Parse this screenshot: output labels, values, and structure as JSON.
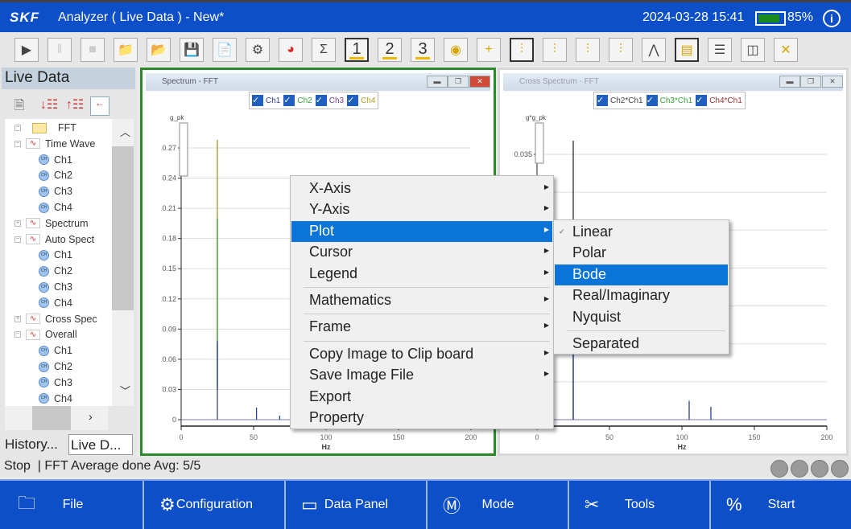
{
  "titlebar": {
    "logo": "SKF",
    "title": "Analyzer ( Live Data ) - New*",
    "datetime": "2024-03-28 15:41",
    "battery_percent": 85,
    "battery_label": "85%",
    "info_icon": "info-icon"
  },
  "toolbar": {
    "buttons": [
      "play",
      "pause",
      "stop",
      "new-folder",
      "open-folder",
      "save",
      "new-report",
      "settings",
      "pie-chart",
      "sigma",
      "layout-1",
      "layout-2",
      "layout-3",
      "view-file",
      "add-cursor",
      "single-cursor",
      "harmonic-cursor",
      "band-cursor",
      "sideband-cursor",
      "peak-cursor",
      "annotation",
      "split-horizontal",
      "split-vertical",
      "close-window"
    ],
    "layout_labels": [
      "1",
      "2",
      "3"
    ]
  },
  "left_panel": {
    "title": "Live Data",
    "tree": [
      {
        "label": "FFT",
        "type": "folder",
        "level": 0
      },
      {
        "label": "Time Wave",
        "type": "wave",
        "level": 1
      },
      {
        "label": "Ch1",
        "type": "ch",
        "level": 2
      },
      {
        "label": "Ch2",
        "type": "ch",
        "level": 2
      },
      {
        "label": "Ch3",
        "type": "ch",
        "level": 2
      },
      {
        "label": "Ch4",
        "type": "ch",
        "level": 2
      },
      {
        "label": "Spectrum",
        "type": "wave",
        "level": 1
      },
      {
        "label": "Auto Spect",
        "type": "wave",
        "level": 1
      },
      {
        "label": "Ch1",
        "type": "ch",
        "level": 2
      },
      {
        "label": "Ch2",
        "type": "ch",
        "level": 2
      },
      {
        "label": "Ch3",
        "type": "ch",
        "level": 2
      },
      {
        "label": "Ch4",
        "type": "ch",
        "level": 2
      },
      {
        "label": "Cross Spec",
        "type": "wave",
        "level": 1
      },
      {
        "label": "Overall",
        "type": "wave",
        "level": 1
      },
      {
        "label": "Ch1",
        "type": "ch",
        "level": 2
      },
      {
        "label": "Ch2",
        "type": "ch",
        "level": 2
      },
      {
        "label": "Ch3",
        "type": "ch",
        "level": 2
      },
      {
        "label": "Ch4",
        "type": "ch",
        "level": 2
      }
    ],
    "tabs": [
      "History...",
      "Live D..."
    ]
  },
  "windows": [
    {
      "title": "Spectrum - FFT",
      "legend": [
        {
          "name": "Ch1",
          "color": "#2a3f9a"
        },
        {
          "name": "Ch2",
          "color": "#3aa03a"
        },
        {
          "name": "Ch3",
          "color": "#7a3fa0"
        },
        {
          "name": "Ch4",
          "color": "#b0a020"
        }
      ],
      "active": true
    },
    {
      "title": "Cross Spectrum - FFT",
      "legend": [
        {
          "name": "Ch2*Ch1",
          "color": "#444"
        },
        {
          "name": "Ch3*Ch1",
          "color": "#3aa03a"
        },
        {
          "name": "Ch4*Ch1",
          "color": "#a03030"
        }
      ],
      "active": false
    }
  ],
  "chart_data": [
    {
      "type": "line",
      "ylabel": "g_pk",
      "xlabel": "Hz",
      "xlim": [
        0,
        200
      ],
      "ylim": [
        0,
        0.28
      ],
      "xticks": [
        0,
        50,
        100,
        150,
        200
      ],
      "yticks": [
        0,
        0.03,
        0.06,
        0.09,
        0.12,
        0.15,
        0.18,
        0.21,
        0.24,
        0.27
      ],
      "grid": true,
      "peaks": [
        {
          "x": 25,
          "y": 0.278,
          "color": "#9a9a30"
        },
        {
          "x": 25,
          "y": 0.2,
          "color": "#3aa03a"
        },
        {
          "x": 25,
          "y": 0.078,
          "color": "#2a3f9a"
        },
        {
          "x": 25,
          "y": 0.03,
          "color": "#7a7ab0"
        },
        {
          "x": 52,
          "y": 0.012,
          "color": "#2a3f9a"
        },
        {
          "x": 68,
          "y": 0.004,
          "color": "#2a3f9a"
        }
      ]
    },
    {
      "type": "line",
      "ylabel": "g*g_pk",
      "xlabel": "Hz",
      "xlim": [
        0,
        200
      ],
      "ylim": [
        0,
        0.037
      ],
      "xticks": [
        0,
        50,
        100,
        150,
        200
      ],
      "yticks": [
        0.035
      ],
      "grid": true,
      "peaks": [
        {
          "x": 25,
          "y": 0.0368,
          "color": "#333"
        },
        {
          "x": 25,
          "y": 0.013,
          "color": "#2a3f9a"
        },
        {
          "x": 105,
          "y": 0.0025,
          "color": "#2a3f9a"
        },
        {
          "x": 120,
          "y": 0.0017,
          "color": "#2a3f9a"
        }
      ]
    }
  ],
  "context_menu": {
    "items": [
      {
        "label": "X-Axis",
        "sub": true
      },
      {
        "label": "Y-Axis",
        "sub": true
      },
      {
        "label": "Plot",
        "sub": true,
        "selected": true
      },
      {
        "label": "Cursor",
        "sub": true
      },
      {
        "label": "Legend",
        "sub": true
      },
      {
        "sep": true
      },
      {
        "label": "Mathematics",
        "sub": true
      },
      {
        "sep": true
      },
      {
        "label": "Frame",
        "sub": true
      },
      {
        "sep": true
      },
      {
        "label": "Copy Image to Clip board",
        "sub": true
      },
      {
        "label": "Save Image File",
        "sub": true
      },
      {
        "label": "Export",
        "sub": false
      },
      {
        "label": "Property",
        "sub": false
      }
    ]
  },
  "plot_submenu": {
    "items": [
      {
        "label": "Linear",
        "checked": true
      },
      {
        "label": "Polar"
      },
      {
        "label": "Bode",
        "selected": true
      },
      {
        "label": "Real/Imaginary"
      },
      {
        "label": "Nyquist"
      },
      {
        "sep": true
      },
      {
        "label": "Separated"
      }
    ]
  },
  "status": {
    "text": "Stop  | FFT Average done Avg: 5/5"
  },
  "bottom_bar": [
    {
      "label": "File",
      "icon": "folder-icon"
    },
    {
      "label": "Configuration",
      "icon": "gear-sync-icon"
    },
    {
      "label": "Data Panel",
      "icon": "monitor-icon"
    },
    {
      "label": "Mode",
      "icon": "m-box-icon"
    },
    {
      "label": "Tools",
      "icon": "tools-icon"
    },
    {
      "label": "Start",
      "icon": "percent-icon"
    }
  ]
}
